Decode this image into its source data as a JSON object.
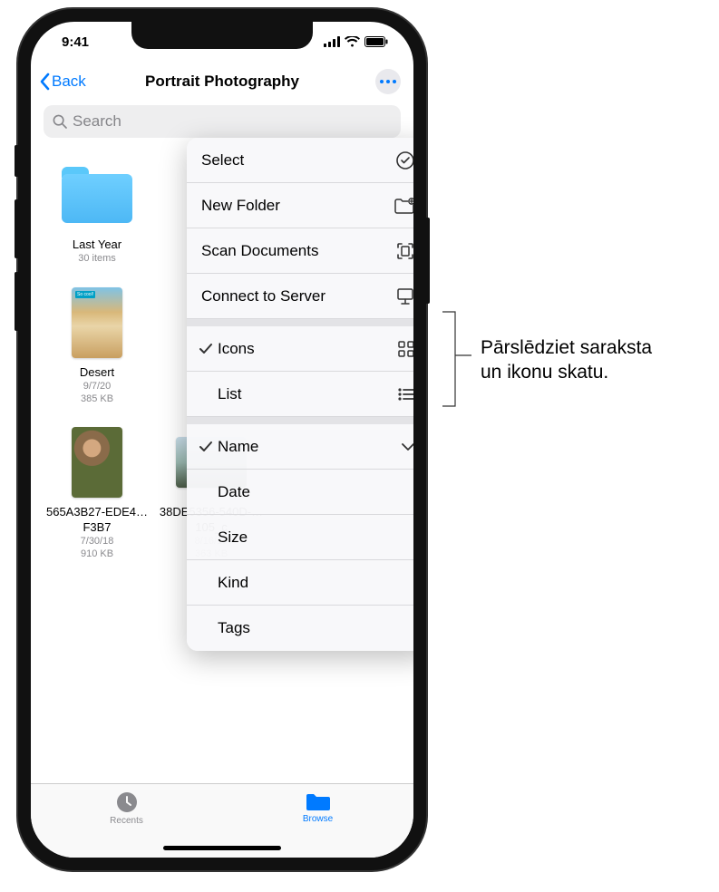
{
  "status": {
    "time": "9:41"
  },
  "nav": {
    "back": "Back",
    "title": "Portrait Photography"
  },
  "search": {
    "placeholder": "Search"
  },
  "popup": {
    "actions": [
      {
        "label": "Select",
        "icon": "select"
      },
      {
        "label": "New Folder",
        "icon": "new-folder"
      },
      {
        "label": "Scan Documents",
        "icon": "scan"
      },
      {
        "label": "Connect to Server",
        "icon": "server"
      }
    ],
    "views": [
      {
        "label": "Icons",
        "icon": "grid",
        "checked": true
      },
      {
        "label": "List",
        "icon": "list",
        "checked": false
      }
    ],
    "sort": [
      {
        "label": "Name",
        "checked": true,
        "chevron": true
      },
      {
        "label": "Date"
      },
      {
        "label": "Size"
      },
      {
        "label": "Kind"
      },
      {
        "label": "Tags"
      }
    ]
  },
  "tiles": [
    {
      "name": "Last Year",
      "meta1": "30 items",
      "type": "folder"
    },
    {
      "name": "Desert",
      "meta1": "9/7/20",
      "meta2": "385 KB",
      "type": "photo",
      "bg": "linear-gradient(180deg,#d9b87a 0%,#e9d5a8 40%,#c99f60 100%)",
      "tag": "So cool!"
    },
    {
      "name": "565A3B27-EDE4…F3B7",
      "meta1": "7/30/18",
      "meta2": "910 KB",
      "type": "photo",
      "bg": "linear-gradient(135deg,#7a8a4d,#5b6b37)"
    },
    {
      "name": "38DE5356-540D-…105_c",
      "meta1": "8/16/19",
      "meta2": "363 KB",
      "type": "photo-wide",
      "bg": "linear-gradient(180deg,#c8dce8 0%,#8aa6a0 60%,#4a5a45 100%)"
    }
  ],
  "tabs": {
    "recents": "Recents",
    "browse": "Browse"
  },
  "callout": {
    "line1": "Pārslēdziet saraksta",
    "line2": "un ikonu skatu."
  }
}
